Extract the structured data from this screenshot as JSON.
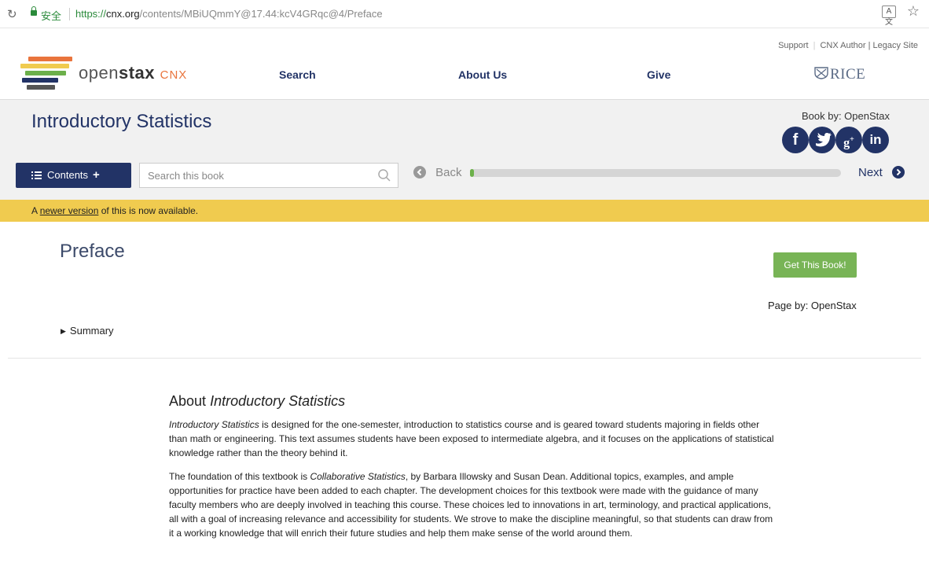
{
  "browser": {
    "secure_label": "安全",
    "url_scheme": "https://",
    "url_host": "cnx.org",
    "url_path": "/contents/MBiUQmmY@17.44:kcV4GRqc@4/Preface"
  },
  "header": {
    "utility_links": [
      "Support",
      "CNX Author | Legacy Site"
    ],
    "logo": {
      "text_light": "open",
      "text_bold": "stax",
      "suffix": "CNX"
    },
    "nav": [
      "Search",
      "About Us",
      "Give"
    ],
    "partner": "RICE",
    "logo_colors": [
      "#e9743c",
      "#f0cb4f",
      "#6cb04a",
      "#223366",
      "#555555"
    ]
  },
  "book": {
    "title": "Introductory Statistics",
    "by_label": "Book by: OpenStax",
    "social": [
      "facebook-icon",
      "twitter-icon",
      "google-plus-icon",
      "linkedin-icon"
    ],
    "contents_label": "Contents",
    "search_placeholder": "Search this book",
    "back_label": "Back",
    "next_label": "Next",
    "progress_fraction": 0.01
  },
  "notice": {
    "prefix": "A",
    "link": "newer version",
    "suffix": "of this is now available."
  },
  "page": {
    "title": "Preface",
    "get_book_label": "Get This Book!",
    "page_by": "Page by: OpenStax",
    "summary_label": "Summary"
  },
  "content": {
    "heading_prefix": "About",
    "heading_em": "Introductory Statistics",
    "p1_em": "Introductory Statistics",
    "p1_text": "is designed for the one-semester, introduction to statistics course and is geared toward students majoring in fields other than math or engineering. This text assumes students have been exposed to intermediate algebra, and it focuses on the applications of statistical knowledge rather than the theory behind it.",
    "p2_prefix": "The foundation of this textbook is",
    "p2_em": "Collaborative Statistics",
    "p2_text": ", by Barbara Illowsky and Susan Dean. Additional topics, examples, and ample opportunities for practice have been added to each chapter. The development choices for this textbook were made with the guidance of many faculty members who are deeply involved in teaching this course. These choices led to innovations in art, terminology, and practical applications, all with a goal of increasing relevance and accessibility for students. We strove to make the discipline meaningful, so that students can draw from it a working knowledge that will enrich their future studies and help them make sense of the world around them."
  },
  "colors": {
    "brand_navy": "#223366",
    "accent_green": "#78b456",
    "notice_yellow": "#f0cb4f"
  }
}
